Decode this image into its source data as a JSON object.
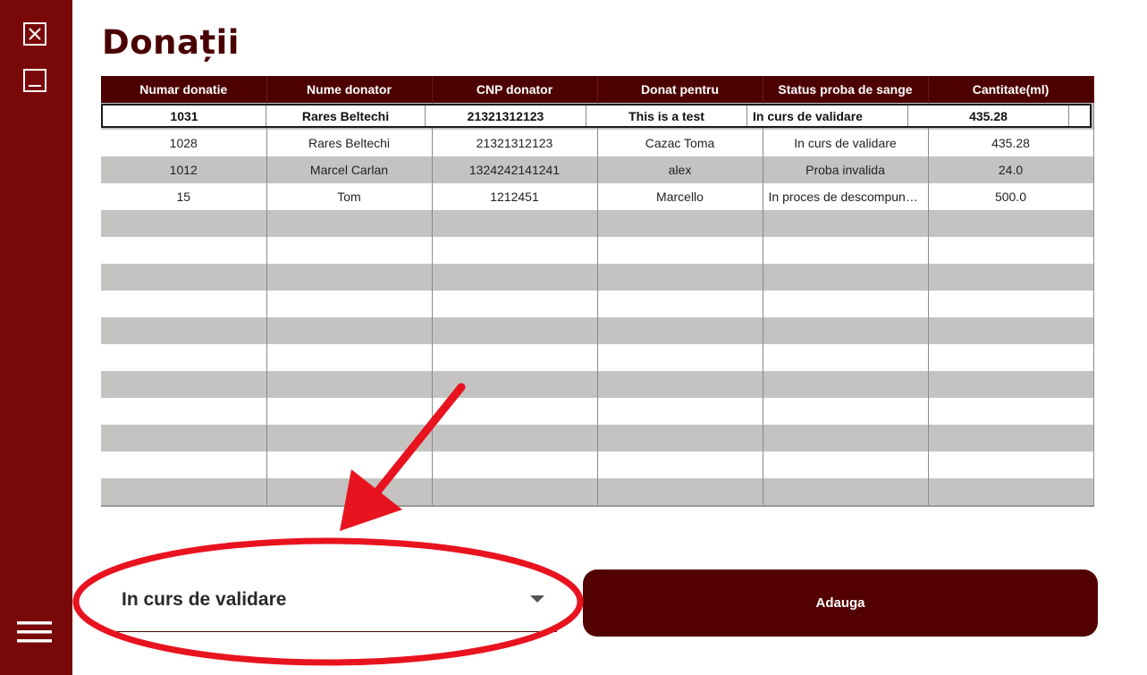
{
  "app": {
    "title": "Donații"
  },
  "sidebar": {
    "icons": [
      "close-box-icon",
      "minimize-icon",
      "hamburger-menu-icon"
    ],
    "color": "#790909"
  },
  "table": {
    "columns": [
      "Numar donatie",
      "Nume donator",
      "CNP donator",
      "Donat pentru",
      "Status proba de sange",
      "Cantitate(ml)"
    ],
    "edit_row": [
      "1031",
      "Rares Beltechi",
      "21321312123",
      "This is a test",
      "In curs de validare",
      "435.28"
    ],
    "rows": [
      [
        "1028",
        "Rares Beltechi",
        "21321312123",
        "Cazac Toma",
        "In curs de validare",
        "435.28"
      ],
      [
        "1012",
        "Marcel Carlan",
        "1324242141241",
        "alex",
        "Proba invalida",
        "24.0"
      ],
      [
        "15",
        "Tom",
        "1212451",
        "Marcello",
        "In proces de descompunere",
        "500.0"
      ]
    ],
    "header_color": "#4d0000",
    "stripe_color": "#c4c3c2"
  },
  "status_select": {
    "value": "In curs de validare"
  },
  "add_button": {
    "label": "Adauga",
    "color": "#520000"
  },
  "annotation": {
    "color": "#e8131f"
  }
}
